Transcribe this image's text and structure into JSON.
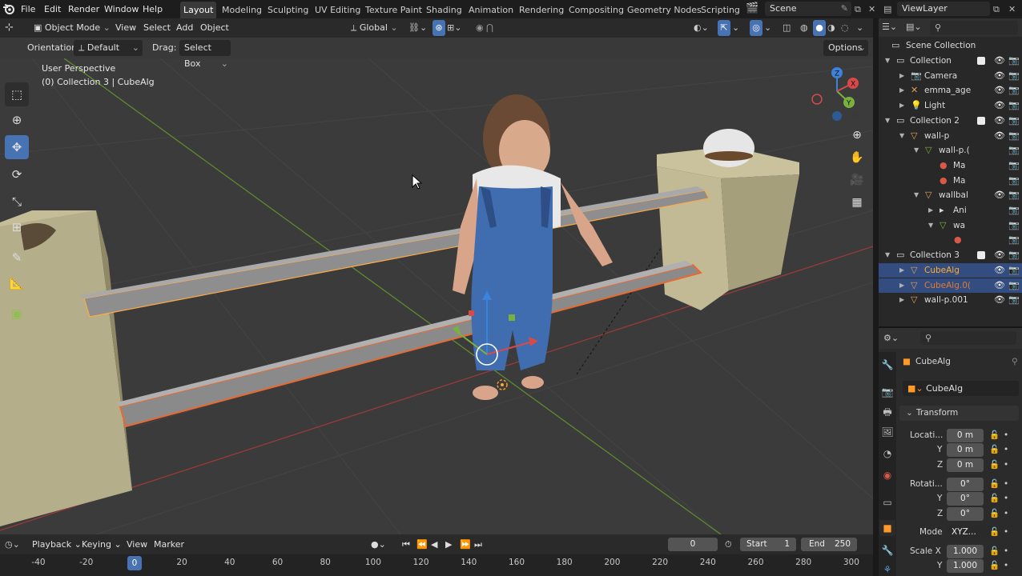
{
  "menu": [
    "File",
    "Edit",
    "Render",
    "Window",
    "Help"
  ],
  "workspaces": [
    "Layout",
    "Modeling",
    "Sculpting",
    "UV Editing",
    "Texture Paint",
    "Shading",
    "Animation",
    "Rendering",
    "Compositing",
    "Geometry Nodes",
    "Scripting"
  ],
  "scene_name": "Scene",
  "view_layer": "ViewLayer",
  "viewport_header": {
    "mode": "Object Mode",
    "menus": [
      "View",
      "Select",
      "Add",
      "Object"
    ],
    "transform_orientation": "Global"
  },
  "tool_header": {
    "orientation_label": "Orientation:",
    "orientation_value": "Default",
    "drag_label": "Drag:",
    "drag_value": "Select Box",
    "options": "Options"
  },
  "overlay": {
    "perspective": "User Perspective",
    "collection_info": "(0) Collection 3 | CubeAlg"
  },
  "gizmo_axes": [
    "X",
    "Y",
    "Z"
  ],
  "outliner": {
    "root": "Scene Collection",
    "rows": [
      {
        "name": "Collection",
        "icon": "collection-icon",
        "color": "#dcdcdc"
      },
      {
        "name": "Camera",
        "icon": "camera-icon",
        "color": "#dcdcdc"
      },
      {
        "name": "emma_age",
        "icon": "armature-icon",
        "color": "#dcdcdc"
      },
      {
        "name": "Light",
        "icon": "light-icon",
        "color": "#dcdcdc"
      },
      {
        "name": "Collection 2",
        "icon": "collection-icon",
        "color": "#dcdcdc"
      },
      {
        "name": "wall-p",
        "icon": "mesh-object-icon",
        "color": "#dcdcdc"
      },
      {
        "name": "wall-p.(",
        "icon": "mesh-data-icon",
        "color": "#dcdcdc"
      },
      {
        "name": "Ma",
        "icon": "material-icon",
        "color": "#dcdcdc"
      },
      {
        "name": "Ma",
        "icon": "material-icon",
        "color": "#dcdcdc"
      },
      {
        "name": "wallbal",
        "icon": "mesh-object-icon",
        "color": "#dcdcdc"
      },
      {
        "name": "Ani",
        "icon": "animation-icon",
        "color": "#dcdcdc"
      },
      {
        "name": "wa",
        "icon": "mesh-data-icon",
        "color": "#dcdcdc"
      },
      {
        "name": "",
        "icon": "material-icon",
        "color": "#dcdcdc"
      },
      {
        "name": "Collection 3",
        "icon": "collection-icon",
        "color": "#dcdcdc"
      },
      {
        "name": "CubeAlg",
        "icon": "mesh-object-icon",
        "color": "#ffaf29"
      },
      {
        "name": "CubeAlg.0(",
        "icon": "mesh-object-icon",
        "color": "#e07b39"
      },
      {
        "name": "wall-p.001",
        "icon": "mesh-object-icon",
        "color": "#dcdcdc"
      }
    ]
  },
  "properties": {
    "object_name": "CubeAlg",
    "data_name": "CubeAlg",
    "panel": "Transform",
    "location": {
      "label": "Locati...",
      "x": "0 m",
      "y": "0 m",
      "z": "0 m"
    },
    "rotation": {
      "label": "Rotati...",
      "x": "0°",
      "y": "0°",
      "z": "0°"
    },
    "axis_labels": [
      "Y",
      "Z"
    ],
    "mode_label": "Mode",
    "mode_value": "XYZ...",
    "scale": {
      "label_x": "Scale X",
      "x": "1.000",
      "label_y": "Y",
      "y": "1.000"
    }
  },
  "timeline": {
    "menus": [
      "Playback",
      "Keying",
      "View",
      "Marker"
    ],
    "current_frame": "0",
    "start_label": "Start",
    "start": "1",
    "end_label": "End",
    "end": "250",
    "ruler": [
      "-40",
      "-20",
      "0",
      "20",
      "40",
      "60",
      "80",
      "100",
      "120",
      "140",
      "160",
      "180",
      "200",
      "220",
      "240",
      "260",
      "280",
      "300"
    ]
  },
  "colors": {
    "accent": "#4772b3",
    "selected_active": "#ffaf29",
    "selected": "#e07b39",
    "x_axis": "#d84a4a",
    "y_axis": "#7ab13d",
    "z_axis": "#3d83d9"
  }
}
